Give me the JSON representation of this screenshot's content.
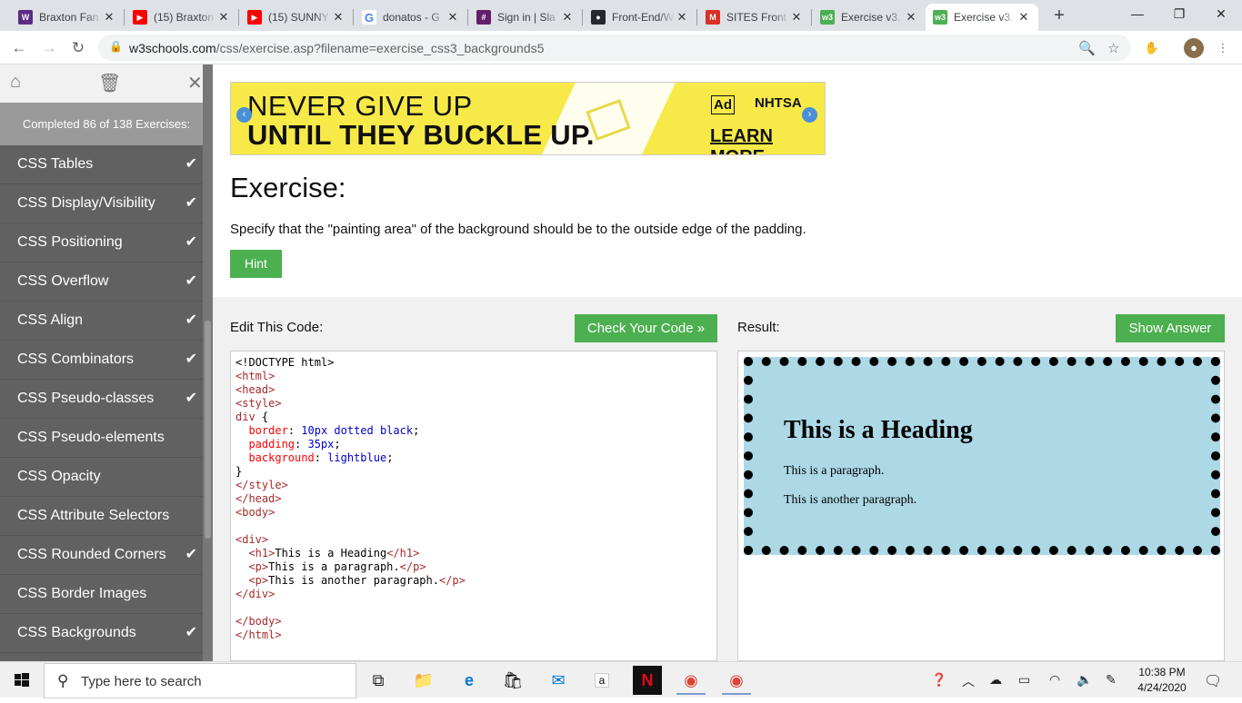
{
  "browser": {
    "tabs": [
      {
        "title": "Braxton Fan",
        "icon": "wetpaint-icon",
        "color": "#5b2c83",
        "glyph": "W"
      },
      {
        "title": "(15) Braxton",
        "icon": "youtube-icon",
        "color": "#ff0000",
        "glyph": "▶"
      },
      {
        "title": "(15) SUNNY",
        "icon": "youtube-icon",
        "color": "#ff0000",
        "glyph": "▶"
      },
      {
        "title": "donatos - G",
        "icon": "google-icon",
        "color": "#4285f4",
        "glyph": "G"
      },
      {
        "title": "Sign in | Sla",
        "icon": "slack-icon",
        "color": "#611f69",
        "glyph": "#"
      },
      {
        "title": "Front-End/W",
        "icon": "github-icon",
        "color": "#24292e",
        "glyph": "●"
      },
      {
        "title": "SITES Front",
        "icon": "gmail-icon",
        "color": "#d93025",
        "glyph": "M"
      },
      {
        "title": "Exercise v3.",
        "icon": "w3schools-icon",
        "color": "#4caf50",
        "glyph": "w3"
      },
      {
        "title": "Exercise v3.",
        "icon": "w3schools-icon",
        "color": "#4caf50",
        "glyph": "w3"
      }
    ],
    "url_host": "w3schools.com",
    "url_path": "/css/exercise.asp?filename=exercise_css3_backgrounds5"
  },
  "sidebar": {
    "progress": "Completed 86 of 138 Exercises:",
    "items": [
      {
        "label": "CSS Tables",
        "done": "✔"
      },
      {
        "label": "CSS Display/Visibility",
        "done": "✔"
      },
      {
        "label": "CSS Positioning",
        "done": "✔"
      },
      {
        "label": "CSS Overflow",
        "done": "✔"
      },
      {
        "label": "CSS Align",
        "done": "✔"
      },
      {
        "label": "CSS Combinators",
        "done": "✔"
      },
      {
        "label": "CSS Pseudo-classes",
        "done": "✔"
      },
      {
        "label": "CSS Pseudo-elements",
        "done": ""
      },
      {
        "label": "CSS Opacity",
        "done": ""
      },
      {
        "label": "CSS Attribute Selectors",
        "done": ""
      },
      {
        "label": "CSS Rounded Corners",
        "done": "✔"
      },
      {
        "label": "CSS Border Images",
        "done": ""
      },
      {
        "label": "CSS Backgrounds",
        "done": "✔"
      }
    ]
  },
  "ad": {
    "line1": "NEVER GIVE UP",
    "line2": "UNTIL THEY BUCKLE UP.",
    "ad_council": "Ad",
    "nhtsa": "NHTSA",
    "cta": "LEARN MORE"
  },
  "exercise": {
    "title": "Exercise:",
    "description": "Specify that the \"painting area\" of the background should be to the outside edge of the padding.",
    "hint_label": "Hint",
    "edit_label": "Edit This Code:",
    "check_label": "Check Your Code »",
    "result_label": "Result:",
    "answer_label": "Show Answer"
  },
  "result": {
    "heading": "This is a Heading",
    "p1": "This is a paragraph.",
    "p2": "This is another paragraph."
  },
  "taskbar": {
    "search_placeholder": "Type here to search",
    "time": "10:38 PM",
    "date": "4/24/2020"
  }
}
